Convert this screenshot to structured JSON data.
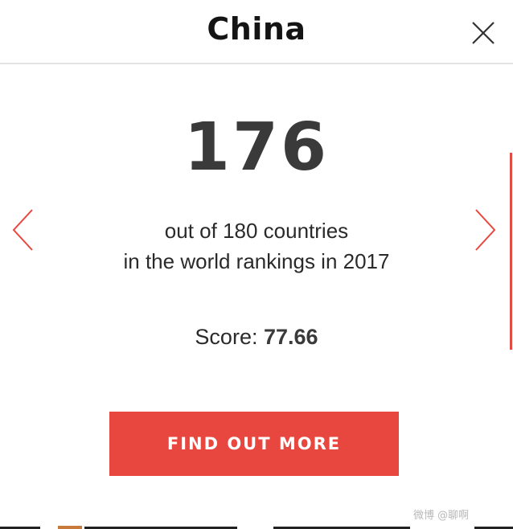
{
  "header": {
    "title": "China",
    "close_icon": "close-icon"
  },
  "ranking": {
    "rank": "176",
    "line1": "out of 180 countries",
    "line2": "in the world rankings in 2017",
    "score_label": "Score:",
    "score_value": "77.66"
  },
  "navigation": {
    "prev_icon": "chevron-left-icon",
    "next_icon": "chevron-right-icon"
  },
  "cta": {
    "label": "FIND OUT MORE"
  },
  "watermark": {
    "text": "微博 @聊啊"
  },
  "colors": {
    "accent": "#e8473f",
    "text_dark": "#141414",
    "rank_text": "#3a3a3a",
    "divider": "#e3e3e3"
  }
}
